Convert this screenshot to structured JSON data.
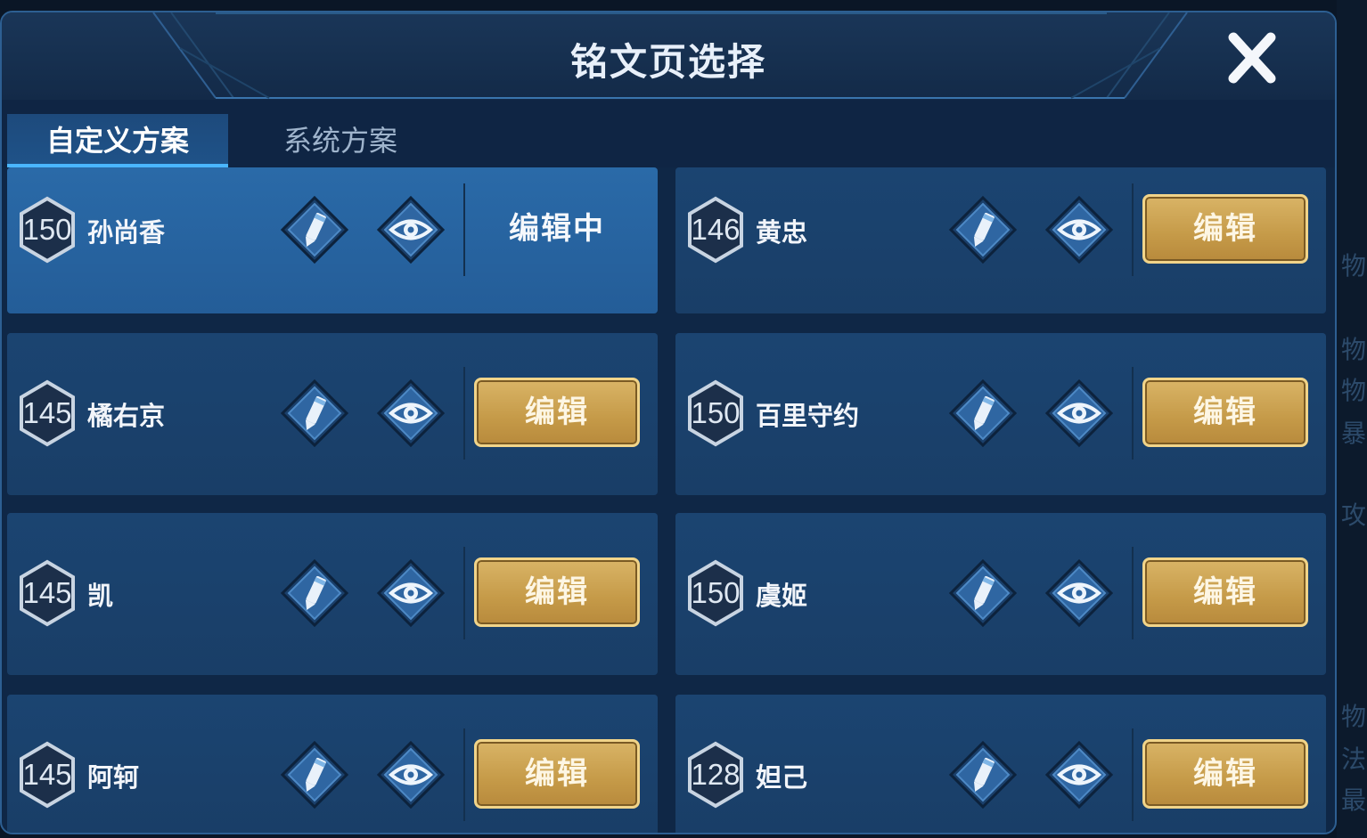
{
  "title": "铭文页选择",
  "tabs": [
    {
      "label": "自定义方案"
    },
    {
      "label": "系统方案"
    }
  ],
  "edit_label": "编辑",
  "editing_label": "编辑中",
  "background_chars": [
    "物",
    "物",
    "物",
    "暴",
    "攻",
    "物",
    "法",
    "最"
  ],
  "pages": [
    {
      "level": "150",
      "hero": "孙尚香",
      "state": "editing"
    },
    {
      "level": "146",
      "hero": "黄忠",
      "state": "edit"
    },
    {
      "level": "145",
      "hero": "橘右京",
      "state": "edit"
    },
    {
      "level": "150",
      "hero": "百里守约",
      "state": "edit"
    },
    {
      "level": "145",
      "hero": "凯",
      "state": "edit"
    },
    {
      "level": "150",
      "hero": "虞姬",
      "state": "edit"
    },
    {
      "level": "145",
      "hero": "阿轲",
      "state": "edit"
    },
    {
      "level": "128",
      "hero": "妲己",
      "state": "edit"
    }
  ],
  "icons": {
    "close": "close-icon",
    "pencil": "pencil-icon",
    "eye": "eye-icon",
    "hexagon": "hexagon-badge-icon"
  },
  "colors": {
    "gold_button": "#c59a48",
    "active_card": "#2a6aa8",
    "card": "#1b4471",
    "tab_underline": "#4ab6ff"
  }
}
